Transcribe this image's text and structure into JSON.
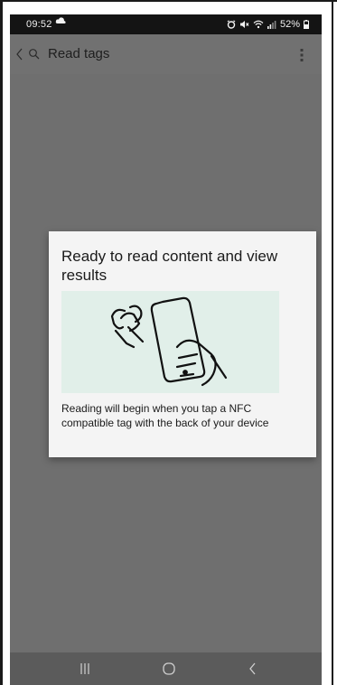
{
  "status_bar": {
    "time": "09:52",
    "battery": "52%"
  },
  "app_bar": {
    "title": "Read tags"
  },
  "dialog": {
    "title": "Ready to read content and view results",
    "body": "Reading will begin when you tap a NFC compatible tag with the back of your device",
    "illustration_bg": "#e1efe9"
  },
  "colors": {
    "status_bar_bg": "#141414",
    "scrim": "#6f6f6f",
    "dialog_bg": "#f4f4f4",
    "nav_bar_bg": "#5b5b5b"
  },
  "icons": {
    "status": [
      "cloud-icon",
      "alarm-icon",
      "mute-icon",
      "wifi-icon",
      "signal-icon",
      "battery-icon"
    ],
    "app_bar": [
      "back-chevron-icon",
      "search-icon",
      "more-vertical-icon"
    ],
    "nav": [
      "recents-icon",
      "home-icon",
      "back-icon"
    ]
  }
}
